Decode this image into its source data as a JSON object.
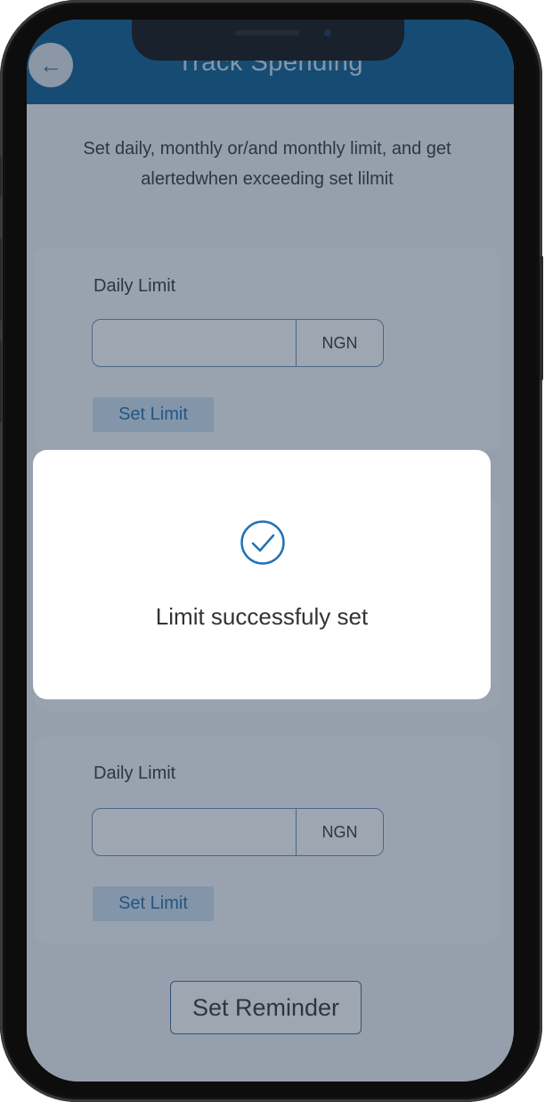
{
  "header": {
    "title": "Track Spending",
    "back_icon": "←"
  },
  "intro_text": "Set daily, monthly or/and monthly limit, and get alertedwhen exceeding set lilmit",
  "cards": [
    {
      "label": "Daily Limit",
      "value": "",
      "currency": "NGN",
      "button_label": "Set Limit"
    },
    {
      "label": "Daily Limit",
      "value": "",
      "currency": "NGN",
      "button_label": "Set Limit"
    }
  ],
  "reminder_button": "Set Reminder",
  "modal": {
    "message": "Limit successfuly set",
    "icon": "check-circle-icon",
    "accent_color": "#1f72b8"
  },
  "colors": {
    "header_bg": "#0a5a91",
    "button_bg": "#cfe0f0",
    "button_text": "#1f6ea9"
  }
}
